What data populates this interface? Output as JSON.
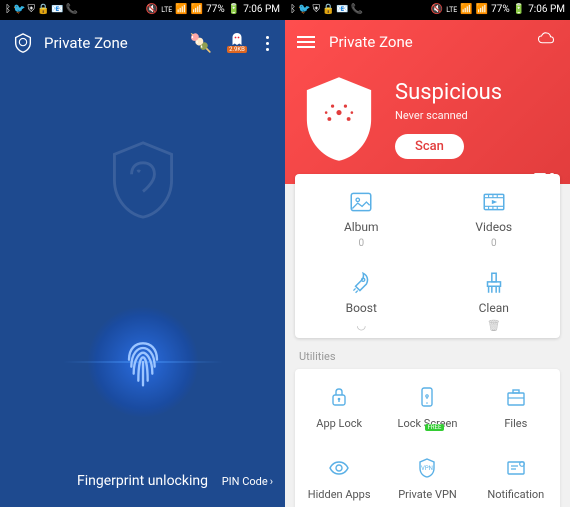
{
  "status": {
    "battery": "77%",
    "time": "7:06 PM"
  },
  "left": {
    "app_title": "Private Zone",
    "ghost_label": "2.9KB",
    "fingerprint_text": "Fingerprint unlocking",
    "pin_link": "PIN Code"
  },
  "right": {
    "app_title": "Private Zone",
    "hero": {
      "heading": "Suspicious",
      "sub": "Never scanned",
      "scan": "Scan"
    },
    "main": {
      "album": {
        "label": "Album",
        "sub": "0"
      },
      "videos": {
        "label": "Videos",
        "sub": "0"
      },
      "boost": {
        "label": "Boost"
      },
      "clean": {
        "label": "Clean"
      }
    },
    "utilities_label": "Utilities",
    "util": {
      "applock": "App Lock",
      "lockscreen": "Lock Screen",
      "files": "Files",
      "hidden": "Hidden Apps",
      "vpn": "Private VPN",
      "vpn_badge": "FREE",
      "notification": "Notification"
    }
  }
}
